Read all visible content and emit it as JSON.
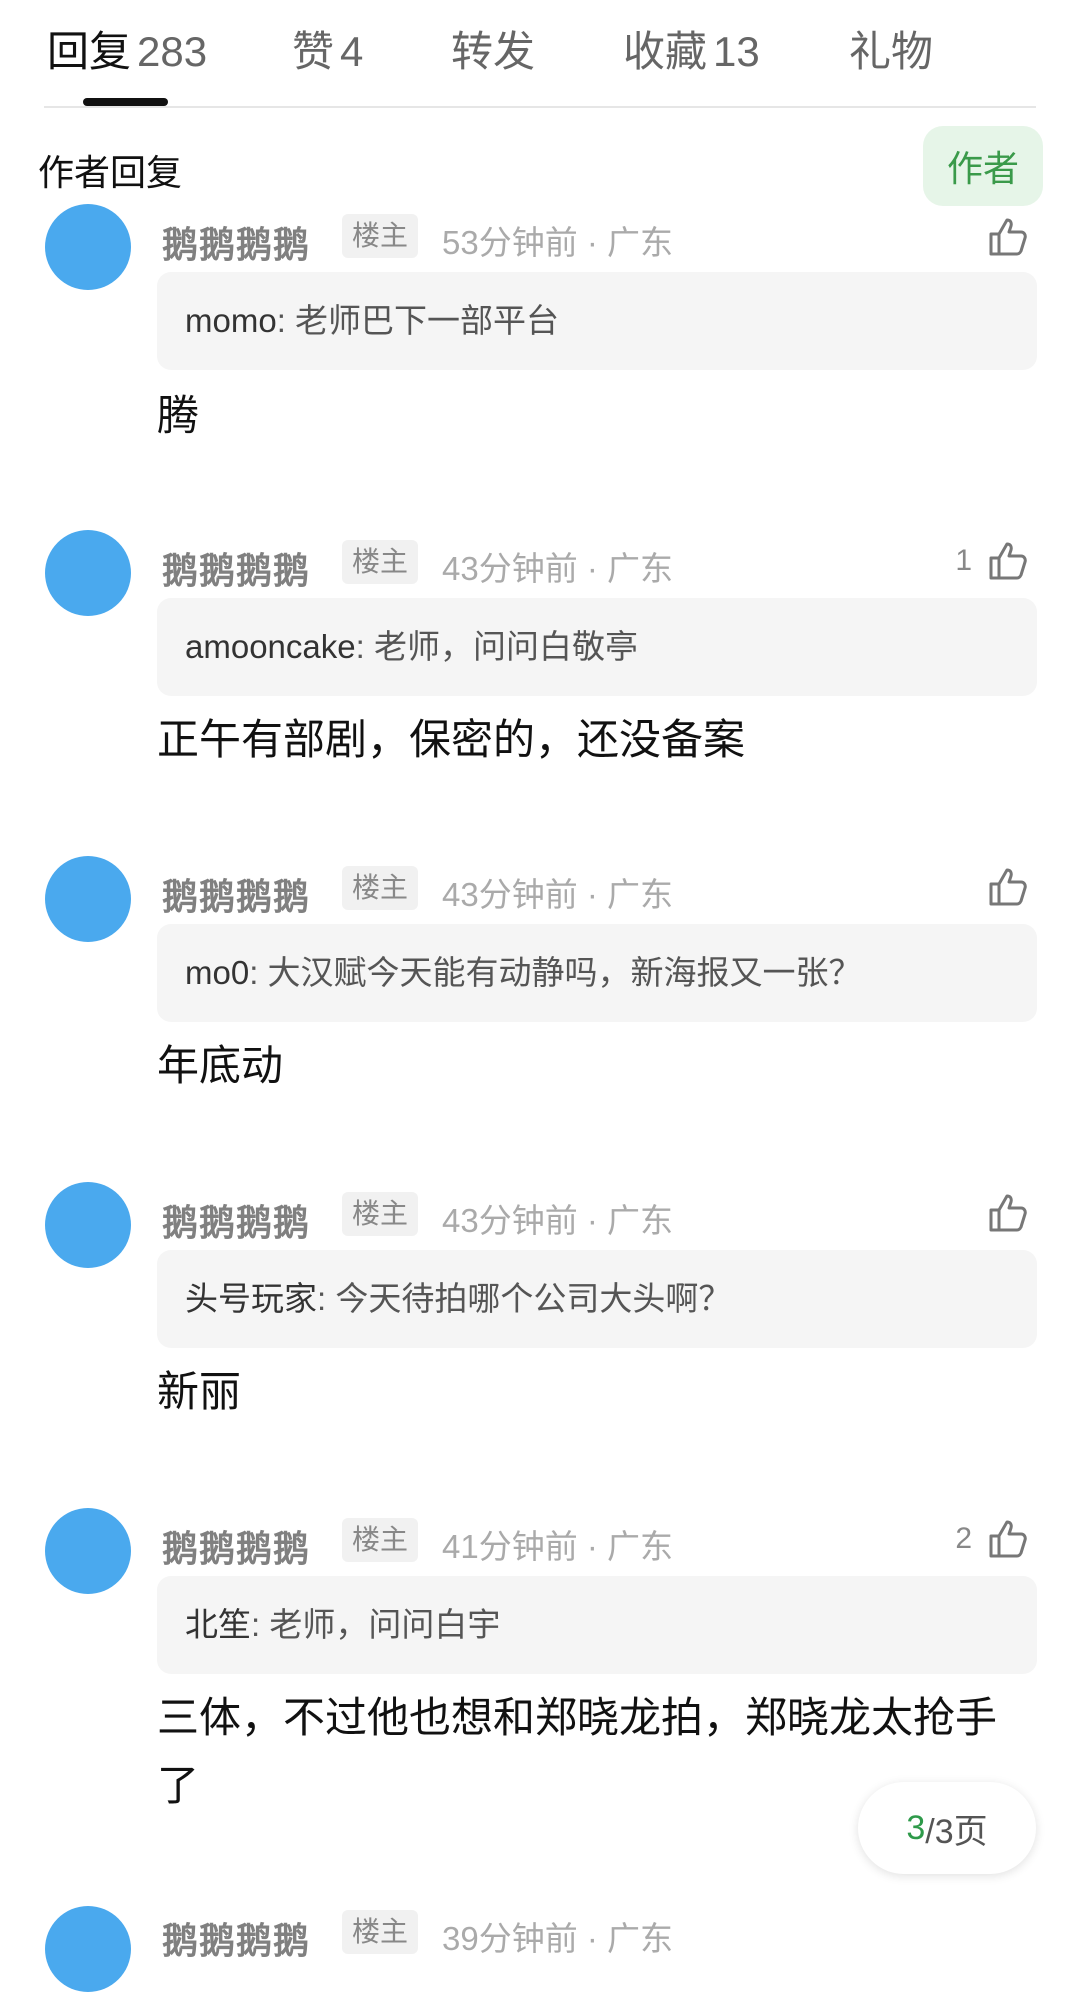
{
  "tabs": [
    {
      "label": "回复",
      "count": "283"
    },
    {
      "label": "赞",
      "count": "4"
    },
    {
      "label": "转发",
      "count": ""
    },
    {
      "label": "收藏",
      "count": "13"
    },
    {
      "label": "礼物",
      "count": ""
    }
  ],
  "filter": {
    "label": "作者回复",
    "toggle": "作者"
  },
  "comments": [
    {
      "name": "鹅鹅鹅鹅",
      "badge": "楼主",
      "time": "53分钟前 · 广东",
      "likes": "",
      "quote_user": "momo",
      "quote_text": "老师巴下一部平台",
      "reply": "腾"
    },
    {
      "name": "鹅鹅鹅鹅",
      "badge": "楼主",
      "time": "43分钟前 · 广东",
      "likes": "1",
      "quote_user": "amooncake",
      "quote_text": "老师，问问白敬亭",
      "reply": "正午有部剧，保密的，还没备案"
    },
    {
      "name": "鹅鹅鹅鹅",
      "badge": "楼主",
      "time": "43分钟前 · 广东",
      "likes": "",
      "quote_user": "mo0",
      "quote_text": "大汉赋今天能有动静吗，新海报又一张？",
      "reply": "年底动"
    },
    {
      "name": "鹅鹅鹅鹅",
      "badge": "楼主",
      "time": "43分钟前 · 广东",
      "likes": "",
      "quote_user": "头号玩家",
      "quote_text": "今天待拍哪个公司大头啊？",
      "reply": "新丽"
    },
    {
      "name": "鹅鹅鹅鹅",
      "badge": "楼主",
      "time": "41分钟前 · 广东",
      "likes": "2",
      "quote_user": "北笙",
      "quote_text": "老师，问问白宇",
      "reply": "三体，不过他也想和郑晓龙拍，郑晓龙太抢手了"
    },
    {
      "name": "鹅鹅鹅鹅",
      "badge": "楼主",
      "time": "39分钟前 · 广东",
      "likes": "",
      "quote_user": "",
      "quote_text": "",
      "reply": ""
    }
  ],
  "pager": {
    "current": "3",
    "total": "/3页"
  },
  "colors": {
    "accent": "#2e9a4a",
    "avatar": "#4aa9ee",
    "toggle_bg": "#e6f5e8"
  }
}
